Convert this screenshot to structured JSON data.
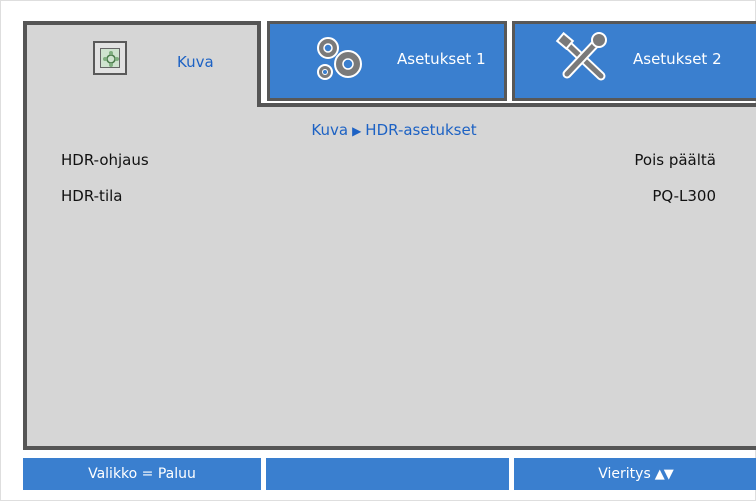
{
  "tabs": [
    {
      "label": "Kuva",
      "icon": "picture-icon",
      "active": true
    },
    {
      "label": "Asetukset 1",
      "icon": "gears-icon",
      "active": false
    },
    {
      "label": "Asetukset 2",
      "icon": "tools-icon",
      "active": false
    }
  ],
  "breadcrumb": {
    "parent": "Kuva",
    "separator": "▶",
    "current": "HDR-asetukset"
  },
  "settings": [
    {
      "label": "HDR-ohjaus",
      "value": "Pois päältä"
    },
    {
      "label": "HDR-tila",
      "value": "PQ-L300"
    }
  ],
  "footer": {
    "left": "Valikko = Paluu",
    "middle": "",
    "right": "Vieritys",
    "right_arrows": "▲▼"
  },
  "colors": {
    "accent_blue": "#3a7fcf",
    "panel_gray": "#d6d6d6",
    "border_dark": "#555555",
    "text_blue": "#1d62c4"
  }
}
